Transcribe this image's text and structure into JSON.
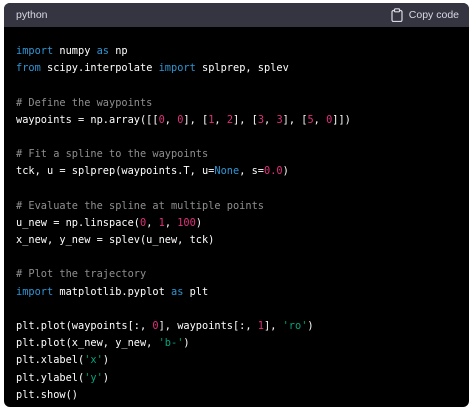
{
  "header": {
    "language": "python",
    "copy_label": "Copy code",
    "copy_icon": "clipboard-icon"
  },
  "colors": {
    "background": "#000000",
    "header_background": "#343541",
    "keyword": "#2e95d3",
    "comment": "#8f8f8f",
    "number": "#df3079",
    "string": "#00a67d",
    "text": "#ffffff"
  },
  "code": {
    "lines": [
      [
        {
          "t": "kw",
          "v": "import"
        },
        {
          "t": "tx",
          "v": " numpy "
        },
        {
          "t": "kw",
          "v": "as"
        },
        {
          "t": "tx",
          "v": " np"
        }
      ],
      [
        {
          "t": "kw",
          "v": "from"
        },
        {
          "t": "tx",
          "v": " scipy.interpolate "
        },
        {
          "t": "kw",
          "v": "import"
        },
        {
          "t": "tx",
          "v": " splprep, splev"
        }
      ],
      [],
      [
        {
          "t": "cm",
          "v": "# Define the waypoints"
        }
      ],
      [
        {
          "t": "tx",
          "v": "waypoints = np.array([["
        },
        {
          "t": "num",
          "v": "0"
        },
        {
          "t": "tx",
          "v": ", "
        },
        {
          "t": "num",
          "v": "0"
        },
        {
          "t": "tx",
          "v": "], ["
        },
        {
          "t": "num",
          "v": "1"
        },
        {
          "t": "tx",
          "v": ", "
        },
        {
          "t": "num",
          "v": "2"
        },
        {
          "t": "tx",
          "v": "], ["
        },
        {
          "t": "num",
          "v": "3"
        },
        {
          "t": "tx",
          "v": ", "
        },
        {
          "t": "num",
          "v": "3"
        },
        {
          "t": "tx",
          "v": "], ["
        },
        {
          "t": "num",
          "v": "5"
        },
        {
          "t": "tx",
          "v": ", "
        },
        {
          "t": "num",
          "v": "0"
        },
        {
          "t": "tx",
          "v": "]])"
        }
      ],
      [],
      [
        {
          "t": "cm",
          "v": "# Fit a spline to the waypoints"
        }
      ],
      [
        {
          "t": "tx",
          "v": "tck, u = splprep(waypoints.T, u="
        },
        {
          "t": "kw",
          "v": "None"
        },
        {
          "t": "tx",
          "v": ", s="
        },
        {
          "t": "num",
          "v": "0.0"
        },
        {
          "t": "tx",
          "v": ")"
        }
      ],
      [],
      [
        {
          "t": "cm",
          "v": "# Evaluate the spline at multiple points"
        }
      ],
      [
        {
          "t": "tx",
          "v": "u_new = np.linspace("
        },
        {
          "t": "num",
          "v": "0"
        },
        {
          "t": "tx",
          "v": ", "
        },
        {
          "t": "num",
          "v": "1"
        },
        {
          "t": "tx",
          "v": ", "
        },
        {
          "t": "num",
          "v": "100"
        },
        {
          "t": "tx",
          "v": ")"
        }
      ],
      [
        {
          "t": "tx",
          "v": "x_new, y_new = splev(u_new, tck)"
        }
      ],
      [],
      [
        {
          "t": "cm",
          "v": "# Plot the trajectory"
        }
      ],
      [
        {
          "t": "kw",
          "v": "import"
        },
        {
          "t": "tx",
          "v": " matplotlib.pyplot "
        },
        {
          "t": "kw",
          "v": "as"
        },
        {
          "t": "tx",
          "v": " plt"
        }
      ],
      [],
      [
        {
          "t": "tx",
          "v": "plt.plot(waypoints[:, "
        },
        {
          "t": "num",
          "v": "0"
        },
        {
          "t": "tx",
          "v": "], waypoints[:, "
        },
        {
          "t": "num",
          "v": "1"
        },
        {
          "t": "tx",
          "v": "], "
        },
        {
          "t": "str",
          "v": "'ro'"
        },
        {
          "t": "tx",
          "v": ")"
        }
      ],
      [
        {
          "t": "tx",
          "v": "plt.plot(x_new, y_new, "
        },
        {
          "t": "str",
          "v": "'b-'"
        },
        {
          "t": "tx",
          "v": ")"
        }
      ],
      [
        {
          "t": "tx",
          "v": "plt.xlabel("
        },
        {
          "t": "str",
          "v": "'x'"
        },
        {
          "t": "tx",
          "v": ")"
        }
      ],
      [
        {
          "t": "tx",
          "v": "plt.ylabel("
        },
        {
          "t": "str",
          "v": "'y'"
        },
        {
          "t": "tx",
          "v": ")"
        }
      ],
      [
        {
          "t": "tx",
          "v": "plt.show()"
        }
      ]
    ]
  }
}
